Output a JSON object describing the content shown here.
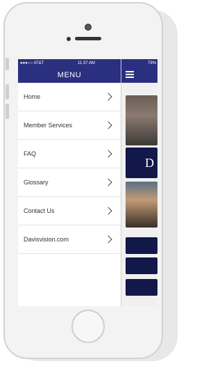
{
  "status_bar": {
    "carrier": "●●●○○ AT&T",
    "time": "11:37 AM",
    "battery": "79%"
  },
  "menu": {
    "title": "MENU",
    "items": [
      {
        "label": "Home"
      },
      {
        "label": "Member Services"
      },
      {
        "label": "FAQ"
      },
      {
        "label": "Glossary"
      },
      {
        "label": "Contact Us"
      },
      {
        "label": "Davisvision.com"
      }
    ]
  },
  "content": {
    "banner_letter": "D"
  },
  "colors": {
    "header_blue": "#2b2f7f",
    "navy": "#12184a"
  }
}
